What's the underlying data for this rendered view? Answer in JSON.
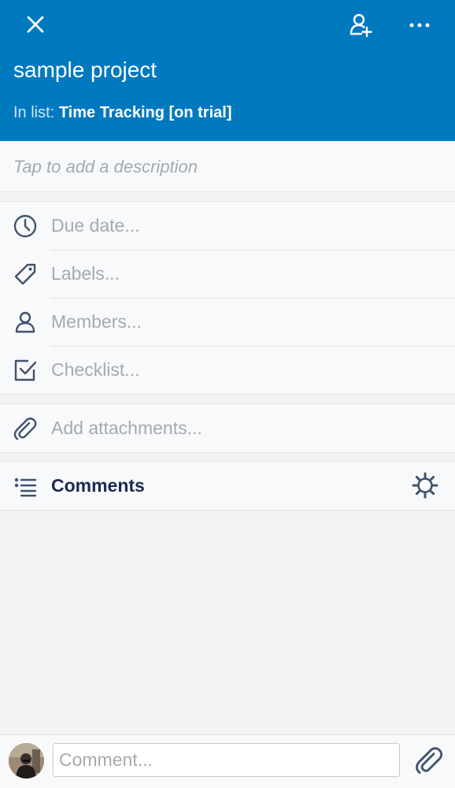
{
  "header": {
    "title": "sample project",
    "in_list_label": "In list:",
    "in_list_value": "Time Tracking [on trial]",
    "icons": [
      "close-icon",
      "add-member-icon",
      "more-icon"
    ],
    "background_color": "#0079bf"
  },
  "description": {
    "placeholder": "Tap to add a description"
  },
  "properties": [
    {
      "label": "Due date...",
      "icon": "clock-icon"
    },
    {
      "label": "Labels...",
      "icon": "label-tag-icon"
    },
    {
      "label": "Members...",
      "icon": "person-icon"
    },
    {
      "label": "Checklist...",
      "icon": "checkbox-icon"
    }
  ],
  "attachments": {
    "label": "Add attachments...",
    "icon": "paperclip-icon"
  },
  "comments": {
    "title": "Comments",
    "icons": [
      "list-icon",
      "gear-icon"
    ]
  },
  "composer": {
    "placeholder": "Comment...",
    "icons": [
      "avatar",
      "paperclip-icon"
    ]
  }
}
